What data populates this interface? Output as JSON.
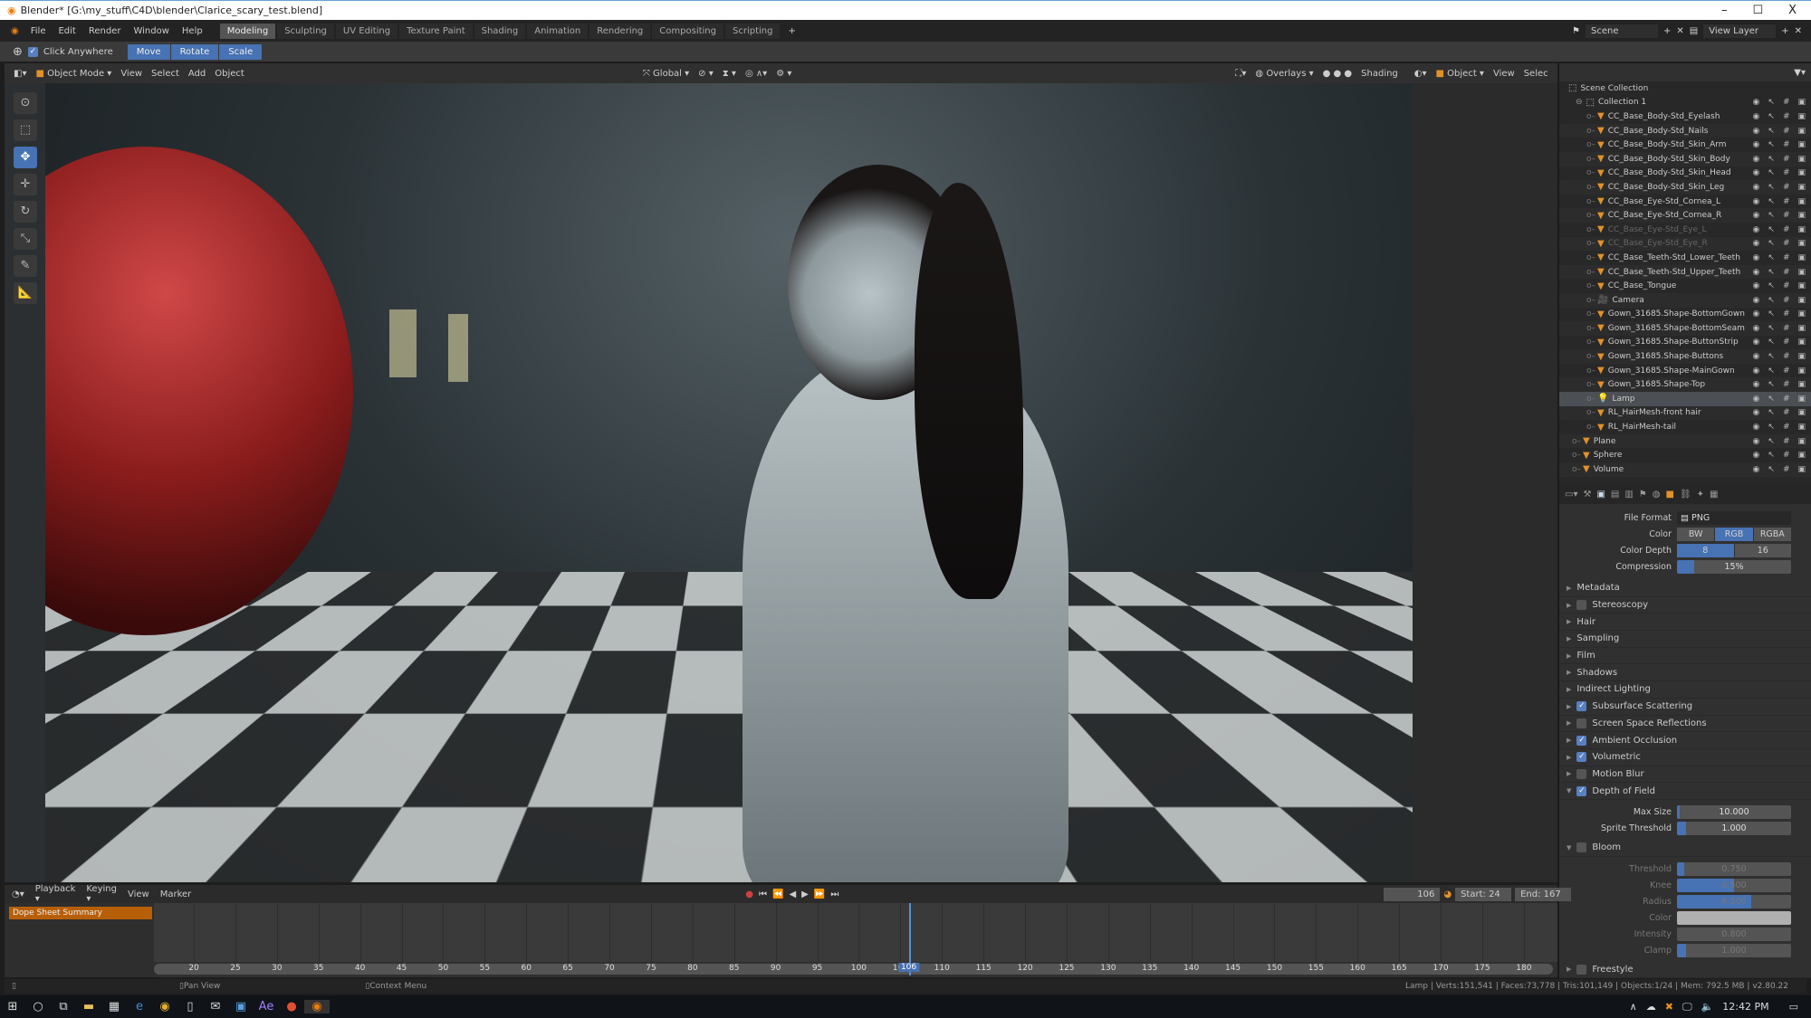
{
  "window": {
    "title": "Blender* [G:\\my_stuff\\C4D\\blender\\Clarice_scary_test.blend]",
    "minimize": "–",
    "maximize": "☐",
    "close": "X"
  },
  "menu": [
    "File",
    "Edit",
    "Render",
    "Window",
    "Help"
  ],
  "workspaces": [
    {
      "label": "Modeling",
      "active": true
    },
    {
      "label": "Sculpting"
    },
    {
      "label": "UV Editing"
    },
    {
      "label": "Texture Paint"
    },
    {
      "label": "Shading"
    },
    {
      "label": "Animation"
    },
    {
      "label": "Rendering"
    },
    {
      "label": "Compositing"
    },
    {
      "label": "Scripting"
    }
  ],
  "add_workspace": "+",
  "scene": {
    "scene_name": "Scene",
    "view_layer": "View Layer"
  },
  "tool_settings": {
    "click_anywhere": "Click Anywhere",
    "move": "Move",
    "rotate": "Rotate",
    "scale": "Scale"
  },
  "viewport_header": {
    "mode": "Object Mode",
    "view": "View",
    "select": "Select",
    "add": "Add",
    "object": "Object",
    "orientation": "Global",
    "overlays": "Overlays",
    "shading": "Shading"
  },
  "outliner_header": {
    "display": "Object",
    "view": "View",
    "select": "Selec"
  },
  "tools": [
    "cursor",
    "select-box",
    "transform",
    "move",
    "rotate",
    "scale",
    "annotate",
    "measure"
  ],
  "outliner": {
    "root": "Scene Collection",
    "collection": "Collection 1",
    "items": [
      {
        "name": "CC_Base_Body-Std_Eyelash",
        "type": "mesh"
      },
      {
        "name": "CC_Base_Body-Std_Nails",
        "type": "mesh"
      },
      {
        "name": "CC_Base_Body-Std_Skin_Arm",
        "type": "mesh"
      },
      {
        "name": "CC_Base_Body-Std_Skin_Body",
        "type": "mesh"
      },
      {
        "name": "CC_Base_Body-Std_Skin_Head",
        "type": "mesh"
      },
      {
        "name": "CC_Base_Body-Std_Skin_Leg",
        "type": "mesh"
      },
      {
        "name": "CC_Base_Eye-Std_Cornea_L",
        "type": "mesh"
      },
      {
        "name": "CC_Base_Eye-Std_Cornea_R",
        "type": "mesh"
      },
      {
        "name": "CC_Base_Eye-Std_Eye_L",
        "type": "mesh",
        "hidden": true
      },
      {
        "name": "CC_Base_Eye-Std_Eye_R",
        "type": "mesh",
        "hidden": true
      },
      {
        "name": "CC_Base_Teeth-Std_Lower_Teeth",
        "type": "mesh"
      },
      {
        "name": "CC_Base_Teeth-Std_Upper_Teeth",
        "type": "mesh"
      },
      {
        "name": "CC_Base_Tongue",
        "type": "mesh"
      },
      {
        "name": "Camera",
        "type": "camera"
      },
      {
        "name": "Gown_31685.Shape-BottomGown",
        "type": "mesh"
      },
      {
        "name": "Gown_31685.Shape-BottomSeam",
        "type": "mesh"
      },
      {
        "name": "Gown_31685.Shape-ButtonStrip",
        "type": "mesh"
      },
      {
        "name": "Gown_31685.Shape-Buttons",
        "type": "mesh"
      },
      {
        "name": "Gown_31685.Shape-MainGown",
        "type": "mesh"
      },
      {
        "name": "Gown_31685.Shape-Top",
        "type": "mesh"
      },
      {
        "name": "Lamp",
        "type": "light",
        "selected": true
      },
      {
        "name": "RL_HairMesh-front hair",
        "type": "mesh"
      },
      {
        "name": "RL_HairMesh-tail",
        "type": "mesh"
      }
    ],
    "top_items": [
      {
        "name": "Plane",
        "type": "mesh"
      },
      {
        "name": "Sphere",
        "type": "mesh"
      },
      {
        "name": "Volume",
        "type": "mesh"
      }
    ]
  },
  "properties": {
    "file_format_label": "File Format",
    "file_format": "PNG",
    "color_label": "Color",
    "color_options": [
      "BW",
      "RGB",
      "RGBA"
    ],
    "color_selected": "RGB",
    "color_depth_label": "Color Depth",
    "color_depth_options": [
      "8",
      "16"
    ],
    "color_depth_selected": "8",
    "compression_label": "Compression",
    "compression": "15%",
    "compression_value": 0.15,
    "panels": [
      {
        "label": "Metadata"
      },
      {
        "label": "Stereoscopy",
        "checkbox": false
      },
      {
        "label": "Hair"
      },
      {
        "label": "Sampling"
      },
      {
        "label": "Film"
      },
      {
        "label": "Shadows"
      },
      {
        "label": "Indirect Lighting"
      },
      {
        "label": "Subsurface Scattering",
        "checkbox": true
      },
      {
        "label": "Screen Space Reflections",
        "checkbox": false
      },
      {
        "label": "Ambient Occlusion",
        "checkbox": true
      },
      {
        "label": "Volumetric",
        "checkbox": true
      },
      {
        "label": "Motion Blur",
        "checkbox": false
      },
      {
        "label": "Depth of Field",
        "checkbox": true,
        "expanded": true
      }
    ],
    "dof": [
      {
        "label": "Max Size",
        "value": "10.000",
        "fill": 0.02
      },
      {
        "label": "Sprite Threshold",
        "value": "1.000",
        "fill": 0.08
      }
    ],
    "bloom": {
      "label": "Bloom",
      "checkbox": false,
      "expanded": true,
      "fields": [
        {
          "label": "Threshold",
          "value": "0.750",
          "fill": 0.06
        },
        {
          "label": "Knee",
          "value": "0.500",
          "fill": 0.5
        },
        {
          "label": "Radius",
          "value": "6.500",
          "fill": 0.65
        },
        {
          "label": "Color",
          "value": "",
          "color": "#b0b0b0"
        },
        {
          "label": "Intensity",
          "value": "0.800",
          "fill": 0
        },
        {
          "label": "Clamp",
          "value": "1.000",
          "fill": 0.08
        }
      ]
    },
    "freestyle": {
      "label": "Freestyle",
      "checkbox": false
    }
  },
  "timeline": {
    "playback": "Playback",
    "keying": "Keying",
    "view": "View",
    "marker": "Marker",
    "current_frame": "106",
    "start_label": "Start:",
    "start": "24",
    "end_label": "End:",
    "end": "167",
    "channel": "Dope Sheet Summary",
    "ticks": [
      20,
      25,
      30,
      35,
      40,
      45,
      50,
      55,
      60,
      65,
      70,
      75,
      80,
      85,
      90,
      95,
      100,
      105,
      110,
      115,
      120,
      125,
      130,
      135,
      140,
      145,
      150,
      155,
      160,
      165,
      170,
      175,
      180
    ],
    "frame_value": 106
  },
  "status": {
    "pan": "Pan View",
    "context": "Context Menu",
    "stats": "Lamp | Verts:151,541 | Faces:73,778 | Tris:101,149 | Objects:1/24 | Mem: 792.5 MB | v2.80.22"
  },
  "taskbar": {
    "time": "12:42 PM"
  },
  "colors": {
    "accent": "#4772b3",
    "selected_channel": "#b75f08",
    "object_icon": "#e2912a"
  }
}
